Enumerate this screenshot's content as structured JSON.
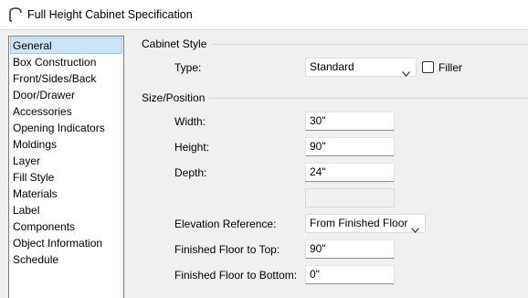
{
  "window": {
    "title": "Full Height Cabinet Specification"
  },
  "sidebar": {
    "items": [
      {
        "label": "General",
        "selected": true
      },
      {
        "label": "Box Construction"
      },
      {
        "label": "Front/Sides/Back"
      },
      {
        "label": "Door/Drawer"
      },
      {
        "label": "Accessories"
      },
      {
        "label": "Opening Indicators"
      },
      {
        "label": "Moldings"
      },
      {
        "label": "Layer"
      },
      {
        "label": "Fill Style"
      },
      {
        "label": "Materials"
      },
      {
        "label": "Label"
      },
      {
        "label": "Components"
      },
      {
        "label": "Object Information"
      },
      {
        "label": "Schedule"
      }
    ]
  },
  "cabinet_style": {
    "group_title": "Cabinet Style",
    "type_label": "Type:",
    "type_value": "Standard",
    "filler_label": "Filler",
    "filler_checked": false
  },
  "size_position": {
    "group_title": "Size/Position",
    "width_label": "Width:",
    "width_value": "30\"",
    "height_label": "Height:",
    "height_value": "90\"",
    "depth_label": "Depth:",
    "depth_value": "24\"",
    "extra_value": "",
    "elevation_label": "Elevation Reference:",
    "elevation_value": "From Finished Floor",
    "floor_top_label": "Finished Floor to Top:",
    "floor_top_value": "90\"",
    "floor_bottom_label": "Finished Floor to Bottom:",
    "floor_bottom_value": "0\""
  }
}
